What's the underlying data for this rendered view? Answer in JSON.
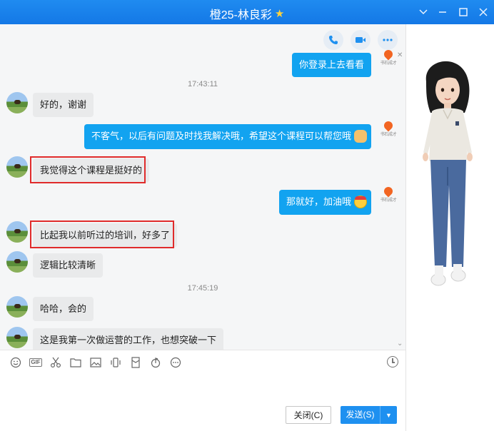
{
  "window": {
    "title": "橙25-林良彩",
    "title_icon": "star-icon",
    "controls": [
      "chevron-down-icon",
      "minimize-icon",
      "maximize-icon",
      "close-icon"
    ]
  },
  "chat_header": {
    "buttons": [
      "phone-call-icon",
      "video-call-icon",
      "more-icon"
    ]
  },
  "messages": {
    "m0": {
      "side": "out",
      "text": "你登录上去看看"
    },
    "t1": "17:43:11",
    "m1": {
      "side": "in",
      "text": "好的，谢谢"
    },
    "m2": {
      "side": "out",
      "text": "不客气，以后有问题及时找我解决哦，希望这个课程可以帮您哦",
      "emoji": "handshake"
    },
    "m3": {
      "side": "in",
      "text": "我觉得这个课程是挺好的",
      "highlighted": true
    },
    "m4": {
      "side": "out",
      "text": "那就好，加油哦",
      "emoji": "determined-face"
    },
    "m5": {
      "side": "in",
      "text": "比起我以前听过的培训，好多了",
      "highlighted": true
    },
    "m6": {
      "side": "in",
      "text": "逻辑比较清晰"
    },
    "t2": "17:45:19",
    "m7": {
      "side": "in",
      "text": "哈哈，会的"
    },
    "m8": {
      "side": "in",
      "text": "这是我第一次做运营的工作，也想突破一下"
    }
  },
  "agent_logo_text": "书石成才",
  "toolbar": {
    "icons": [
      "emoji-icon",
      "gif-icon",
      "scissors-icon",
      "folder-icon",
      "image-icon",
      "shake-icon",
      "red-packet-icon",
      "music-icon",
      "more-tools-icon",
      "history-clock-icon"
    ],
    "gif_label": "GIF"
  },
  "actions": {
    "close_label": "关闭(C)",
    "send_label": "发送(S)"
  },
  "colors": {
    "title_bar": "#1478e6",
    "outgoing_bubble": "#12a3f0",
    "incoming_bubble": "#e9eaeb",
    "highlight_box": "#e02b2b",
    "send_button": "#1e90f0"
  }
}
